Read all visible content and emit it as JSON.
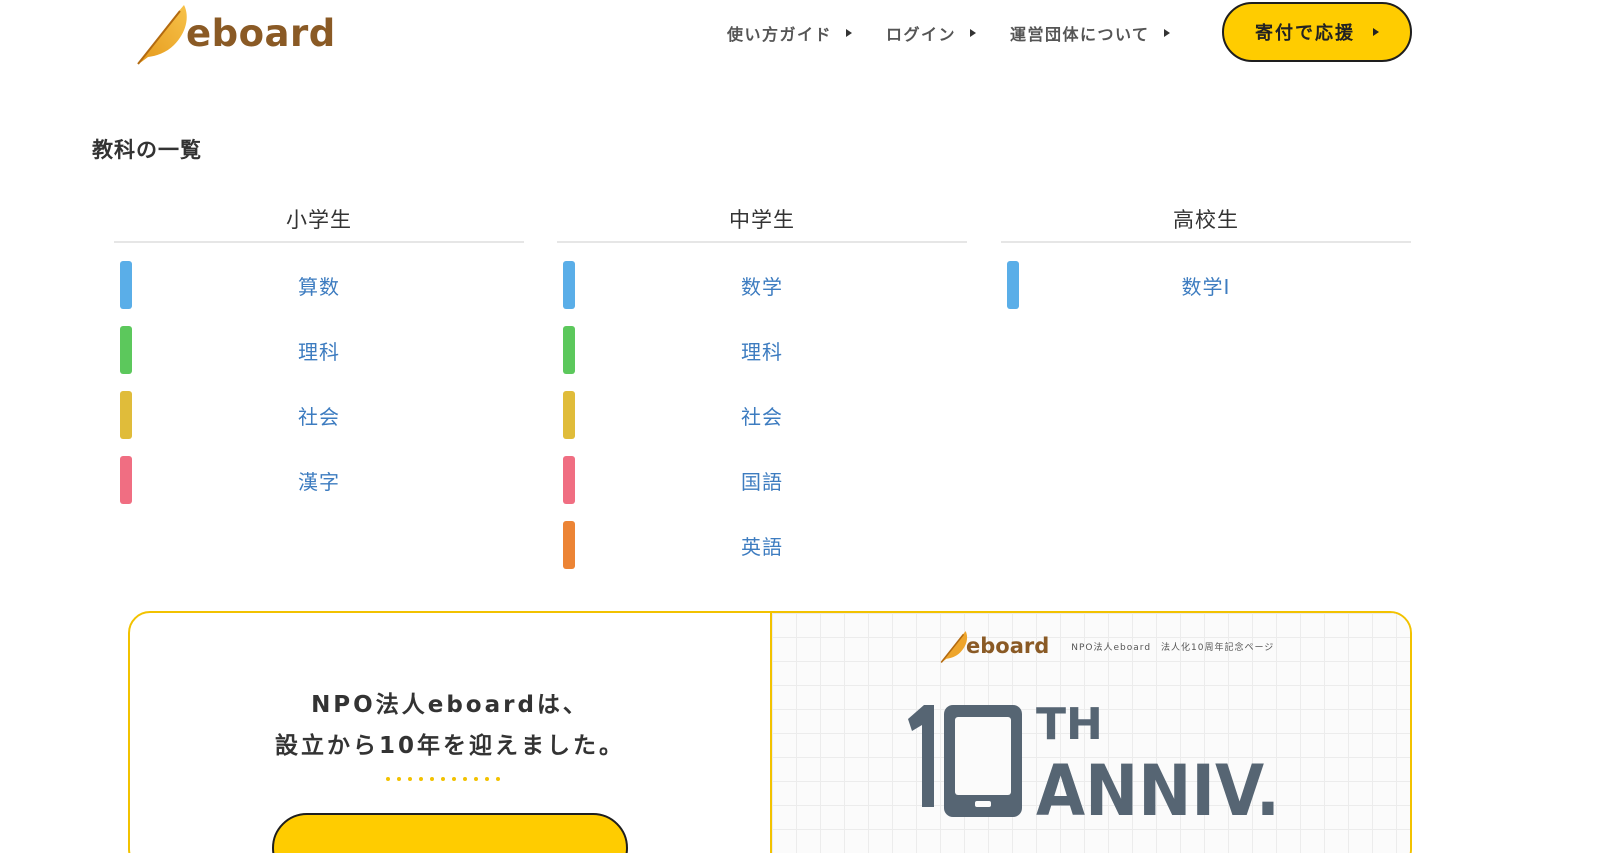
{
  "header": {
    "logo_text": "eboard",
    "nav": [
      {
        "label": "使い方ガイド"
      },
      {
        "label": "ログイン"
      },
      {
        "label": "運営団体について"
      }
    ],
    "donate_label": "寄付で応援"
  },
  "main": {
    "section_title": "教科の一覧",
    "columns": [
      {
        "heading": "小学生",
        "subjects": [
          {
            "label": "算数",
            "color": "#5aaee8"
          },
          {
            "label": "理科",
            "color": "#5cc85c"
          },
          {
            "label": "社会",
            "color": "#e0bc3a"
          },
          {
            "label": "漢字",
            "color": "#f06e82"
          }
        ]
      },
      {
        "heading": "中学生",
        "subjects": [
          {
            "label": "数学",
            "color": "#5aaee8"
          },
          {
            "label": "理科",
            "color": "#5cc85c"
          },
          {
            "label": "社会",
            "color": "#e0bc3a"
          },
          {
            "label": "国語",
            "color": "#f06e82"
          },
          {
            "label": "英語",
            "color": "#ec8435"
          }
        ]
      },
      {
        "heading": "高校生",
        "subjects": [
          {
            "label": "数学I",
            "color": "#5aaee8"
          }
        ]
      }
    ]
  },
  "banner": {
    "line1": "NPO法人eboardは、",
    "line2": "設立から10年を迎えました。",
    "logo_text": "eboard",
    "caption": "NPO法人eboard　法人化10周年記念ページ",
    "anniv_number": "10",
    "anniv_sup": "TH",
    "anniv_text": "ANNIV."
  },
  "colors": {
    "accent_yellow": "#ffcc00",
    "banner_border": "#f2c200",
    "link_blue": "#3d7cc0",
    "logo_brown": "#8a5a25",
    "anniv_slate": "#566573"
  },
  "icons": {
    "logo_mark": "feather-icon",
    "nav_arrow": "triangle-right-icon"
  }
}
